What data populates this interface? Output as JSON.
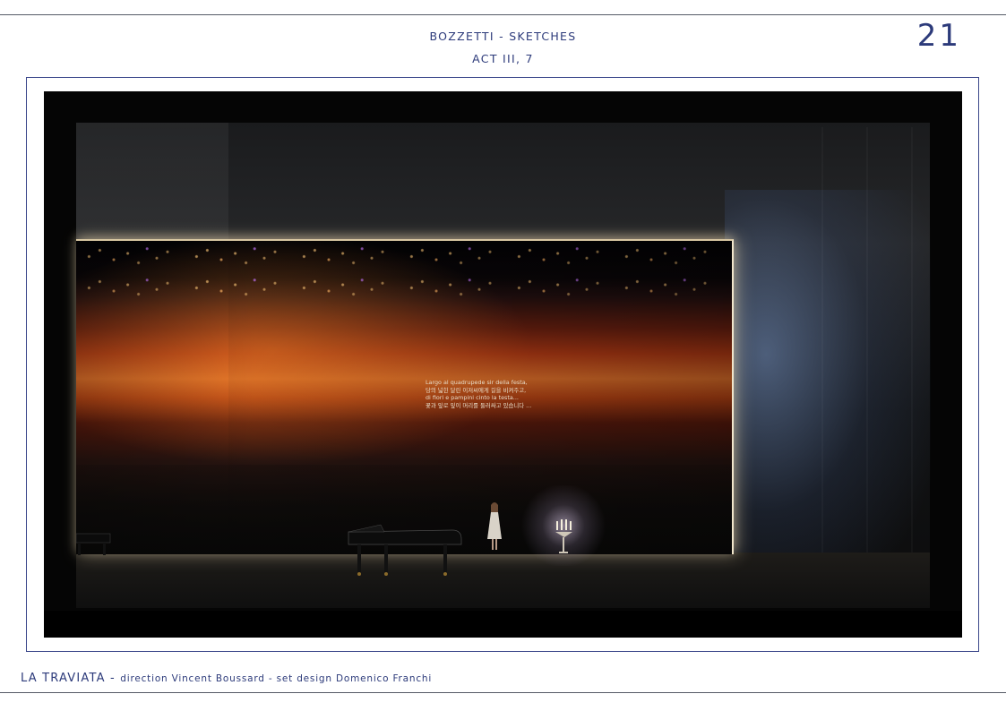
{
  "header": {
    "title": "BOZZETTI - SKETCHES",
    "subtitle": "ACT III, 7",
    "page_number": "21"
  },
  "sketch": {
    "lyrics": [
      "Largo al quadrupede sir della festa,",
      "당의 넓힌 달린 이저씨에게 길을 비켜주고,",
      "di fiori e pampini cinto la testa...",
      "꽃과 잎로 잎이 머리를 둘러싸고 있습니다 ..."
    ]
  },
  "footer": {
    "title": "LA TRAVIATA",
    "separator": " - ",
    "credit": "direction Vincent Boussard - set design Domenico Franchi"
  }
}
